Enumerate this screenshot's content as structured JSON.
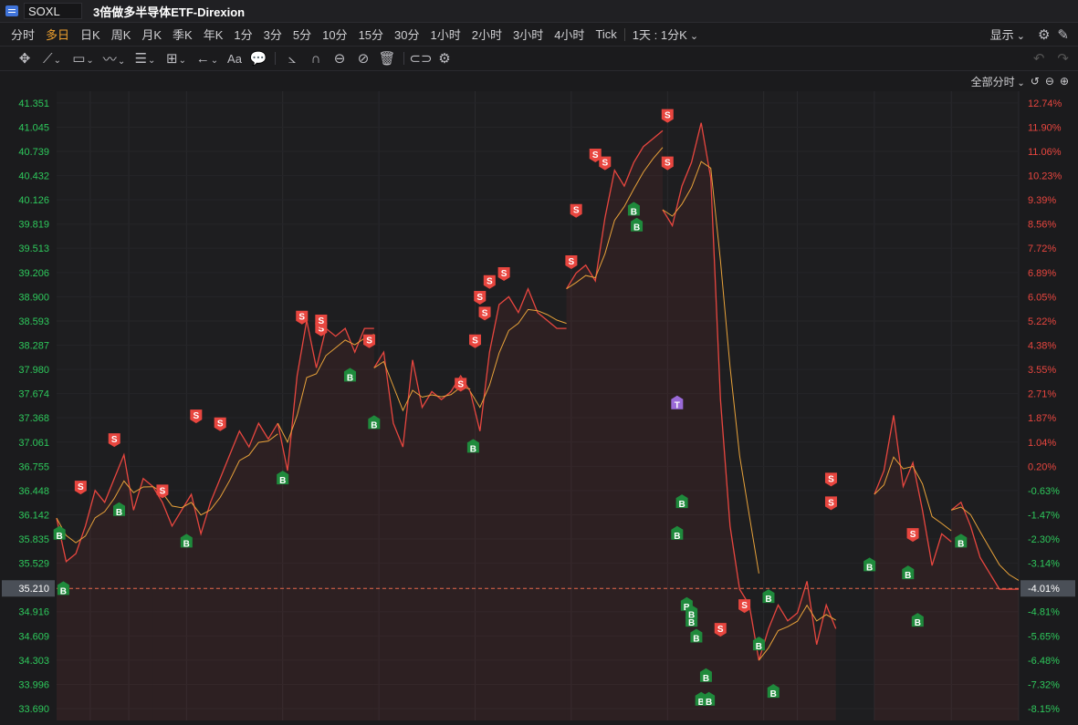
{
  "window": {
    "symbol": "SOXL",
    "name": "3倍做多半导体ETF-Direxion"
  },
  "periods": [
    {
      "label": "分时",
      "active": false
    },
    {
      "label": "多日",
      "active": true
    },
    {
      "label": "日K",
      "active": false
    },
    {
      "label": "周K",
      "active": false
    },
    {
      "label": "月K",
      "active": false
    },
    {
      "label": "季K",
      "active": false
    },
    {
      "label": "年K",
      "active": false
    },
    {
      "label": "1分",
      "active": false
    },
    {
      "label": "3分",
      "active": false
    },
    {
      "label": "5分",
      "active": false
    },
    {
      "label": "10分",
      "active": false
    },
    {
      "label": "15分",
      "active": false
    },
    {
      "label": "30分",
      "active": false
    },
    {
      "label": "1小时",
      "active": false
    },
    {
      "label": "2小时",
      "active": false
    },
    {
      "label": "3小时",
      "active": false
    },
    {
      "label": "4小时",
      "active": false
    },
    {
      "label": "Tick",
      "active": false
    }
  ],
  "interval_selector": "1天 : 1分K",
  "display_label": "显示",
  "time_mode": "全部分时",
  "drawing_tools": {
    "text_tool": "Aa"
  },
  "colors": {
    "price_line": "#e8463f",
    "avg_line": "#e8a23a",
    "sell_marker": "#e8463f",
    "buy_marker": "#1f8a3c",
    "t_marker": "#9a6ad8",
    "axis_left_text": "#2ec95c",
    "axis_right_up": "#e8463f",
    "axis_right_down": "#2ec95c",
    "current_price_line": "#e8684a",
    "current_price_bg": "#4a4f57",
    "background": "#1b1b1d",
    "grid": "#2a2a2e"
  },
  "chart_data": {
    "type": "line",
    "title": "",
    "reference_price": 36.69,
    "current_price": 35.21,
    "current_change": "-4.01%",
    "ylim": [
      33.54,
      41.5
    ],
    "y_ticks_left": [
      "41.351",
      "41.045",
      "40.739",
      "40.432",
      "40.126",
      "39.819",
      "39.513",
      "39.206",
      "38.900",
      "38.593",
      "38.287",
      "37.980",
      "37.674",
      "37.368",
      "37.061",
      "36.755",
      "36.448",
      "36.142",
      "35.835",
      "35.529",
      "35.210",
      "34.916",
      "34.609",
      "34.303",
      "33.996",
      "33.690"
    ],
    "y_ticks_left_values": [
      41.351,
      41.045,
      40.739,
      40.432,
      40.126,
      39.819,
      39.513,
      39.206,
      38.9,
      38.593,
      38.287,
      37.98,
      37.674,
      37.368,
      37.061,
      36.755,
      36.448,
      36.142,
      35.835,
      35.529,
      35.21,
      34.916,
      34.609,
      34.303,
      33.996,
      33.69
    ],
    "y_ticks_right": [
      "12.74%",
      "11.90%",
      "11.06%",
      "10.23%",
      "9.39%",
      "8.56%",
      "7.72%",
      "6.89%",
      "6.05%",
      "5.22%",
      "4.38%",
      "3.55%",
      "2.71%",
      "1.87%",
      "1.04%",
      "0.20%",
      "-0.63%",
      "-1.47%",
      "-2.30%",
      "-3.14%",
      "-4.01%",
      "-4.81%",
      "-5.65%",
      "-6.48%",
      "-7.32%",
      "-8.15%"
    ],
    "x_range": [
      0,
      100
    ],
    "day_separators": [
      3.5,
      7.5,
      13.5,
      23.5,
      33.5,
      43.5,
      53.5,
      63.5,
      73.5,
      77,
      85,
      93,
      100
    ],
    "series": [
      {
        "segments": [
          {
            "x": [
              0,
              1,
              2,
              3,
              4,
              5,
              6,
              7,
              8,
              9,
              10
            ],
            "y": [
              36.1,
              35.55,
              35.65,
              36.0,
              36.45,
              36.3,
              36.6,
              36.9,
              36.2,
              36.6,
              36.5
            ]
          },
          {
            "x": [
              10,
              11,
              12,
              13,
              14,
              15,
              16,
              17,
              18,
              19,
              20,
              21,
              22,
              23
            ],
            "y": [
              36.5,
              36.3,
              36.0,
              36.2,
              36.4,
              35.9,
              36.3,
              36.6,
              36.9,
              37.2,
              37.0,
              37.3,
              37.1,
              37.3
            ]
          },
          {
            "x": [
              23,
              24,
              25,
              26,
              27,
              28,
              29,
              30,
              31,
              32,
              33
            ],
            "y": [
              37.3,
              36.7,
              37.9,
              38.6,
              38.0,
              38.5,
              38.4,
              38.5,
              38.2,
              38.5,
              38.5
            ]
          },
          {
            "x": [
              33,
              34,
              35,
              36,
              37,
              38,
              39,
              40,
              41,
              42,
              43
            ],
            "y": [
              38.0,
              38.2,
              37.3,
              37.0,
              38.1,
              37.5,
              37.7,
              37.6,
              37.7,
              37.9,
              37.7
            ]
          },
          {
            "x": [
              43,
              44,
              45,
              46,
              47,
              48,
              49,
              50,
              51,
              52,
              53
            ],
            "y": [
              37.7,
              37.2,
              38.2,
              38.8,
              38.9,
              38.7,
              39.0,
              38.7,
              38.6,
              38.5,
              38.5
            ]
          },
          {
            "x": [
              53,
              54,
              55,
              56,
              57,
              58,
              59,
              60,
              61,
              62,
              63
            ],
            "y": [
              39.0,
              39.2,
              39.3,
              39.1,
              39.9,
              40.5,
              40.3,
              40.6,
              40.8,
              40.9,
              41.0
            ]
          },
          {
            "x": [
              63,
              64,
              65,
              66,
              67,
              68,
              69,
              70,
              71,
              72,
              73
            ],
            "y": [
              40.0,
              39.8,
              40.3,
              40.6,
              41.1,
              40.4,
              37.6,
              36.0,
              35.2,
              35.0,
              34.3
            ]
          },
          {
            "x": [
              73,
              74,
              75,
              76,
              77,
              78,
              79,
              80,
              81
            ],
            "y": [
              34.3,
              34.7,
              35.0,
              34.8,
              34.9,
              35.3,
              34.5,
              35.0,
              34.7
            ]
          },
          {
            "x": [
              85,
              86,
              87,
              88,
              89,
              90,
              91,
              92,
              93
            ],
            "y": [
              36.4,
              36.7,
              37.4,
              36.5,
              36.8,
              36.2,
              35.5,
              35.9,
              35.8
            ]
          },
          {
            "x": [
              93,
              94,
              95,
              96,
              97,
              98,
              99,
              100
            ],
            "y": [
              36.2,
              36.3,
              36.0,
              35.6,
              35.4,
              35.2,
              35.2,
              35.2
            ]
          }
        ]
      }
    ],
    "markers": [
      {
        "label": "S",
        "x": 2.5,
        "y": 36.4
      },
      {
        "label": "S",
        "x": 6,
        "y": 37.0
      },
      {
        "label": "S",
        "x": 11,
        "y": 36.35
      },
      {
        "label": "S",
        "x": 14.5,
        "y": 37.3
      },
      {
        "label": "S",
        "x": 17,
        "y": 37.2
      },
      {
        "label": "S",
        "x": 25.5,
        "y": 38.55
      },
      {
        "label": "S",
        "x": 27.5,
        "y": 38.4
      },
      {
        "label": "S",
        "x": 27.5,
        "y": 38.5
      },
      {
        "label": "S",
        "x": 32.5,
        "y": 38.25
      },
      {
        "label": "S",
        "x": 42,
        "y": 37.7
      },
      {
        "label": "S",
        "x": 43.5,
        "y": 38.25
      },
      {
        "label": "S",
        "x": 44,
        "y": 38.8
      },
      {
        "label": "S",
        "x": 44.5,
        "y": 38.6
      },
      {
        "label": "S",
        "x": 45,
        "y": 39.0
      },
      {
        "label": "S",
        "x": 46.5,
        "y": 39.1
      },
      {
        "label": "S",
        "x": 53.5,
        "y": 39.25
      },
      {
        "label": "S",
        "x": 54,
        "y": 39.9
      },
      {
        "label": "S",
        "x": 56,
        "y": 40.6
      },
      {
        "label": "S",
        "x": 57,
        "y": 40.5
      },
      {
        "label": "S",
        "x": 63.5,
        "y": 41.1
      },
      {
        "label": "S",
        "x": 63.5,
        "y": 40.5
      },
      {
        "label": "S",
        "x": 69,
        "y": 34.6
      },
      {
        "label": "S",
        "x": 71.5,
        "y": 34.9
      },
      {
        "label": "S",
        "x": 80.5,
        "y": 36.5
      },
      {
        "label": "S",
        "x": 80.5,
        "y": 36.2
      },
      {
        "label": "S",
        "x": 89,
        "y": 35.8
      },
      {
        "label": "B",
        "x": 0.3,
        "y": 36.0
      },
      {
        "label": "B",
        "x": 0.7,
        "y": 35.3
      },
      {
        "label": "B",
        "x": 6.5,
        "y": 36.3
      },
      {
        "label": "B",
        "x": 13.5,
        "y": 35.9
      },
      {
        "label": "B",
        "x": 23.5,
        "y": 36.7
      },
      {
        "label": "B",
        "x": 30.5,
        "y": 38.0
      },
      {
        "label": "B",
        "x": 33,
        "y": 37.4
      },
      {
        "label": "B",
        "x": 43.3,
        "y": 37.1
      },
      {
        "label": "B",
        "x": 60,
        "y": 40.1
      },
      {
        "label": "B",
        "x": 60.3,
        "y": 39.9
      },
      {
        "label": "B",
        "x": 64.5,
        "y": 36.0
      },
      {
        "label": "B",
        "x": 65,
        "y": 36.4
      },
      {
        "label": "B",
        "x": 65.5,
        "y": 35.1
      },
      {
        "label": "B",
        "x": 66,
        "y": 34.9
      },
      {
        "label": "B",
        "x": 66.5,
        "y": 34.7
      },
      {
        "label": "B",
        "x": 66,
        "y": 35.0
      },
      {
        "label": "B",
        "x": 67,
        "y": 33.9
      },
      {
        "label": "B",
        "x": 67.5,
        "y": 34.2
      },
      {
        "label": "B",
        "x": 67.8,
        "y": 33.9
      },
      {
        "label": "B",
        "x": 73,
        "y": 34.6
      },
      {
        "label": "B",
        "x": 74,
        "y": 35.2
      },
      {
        "label": "B",
        "x": 74.5,
        "y": 34.0
      },
      {
        "label": "B",
        "x": 84.5,
        "y": 35.6
      },
      {
        "label": "B",
        "x": 88.5,
        "y": 35.5
      },
      {
        "label": "B",
        "x": 89.5,
        "y": 34.9
      },
      {
        "label": "B",
        "x": 94,
        "y": 35.9
      },
      {
        "label": "T",
        "x": 64.5,
        "y": 37.65
      }
    ]
  }
}
